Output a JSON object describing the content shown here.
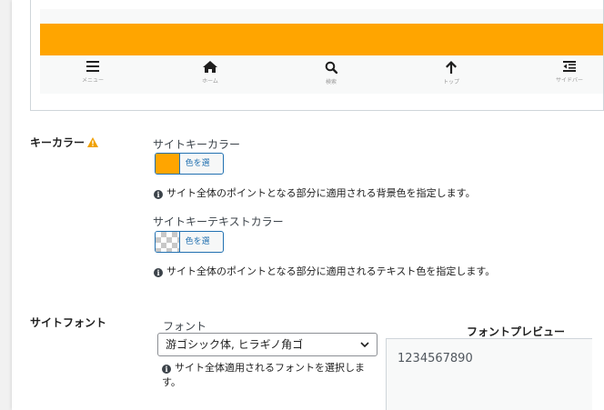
{
  "preview": {
    "accent_color": "#ffa500",
    "nav": [
      {
        "icon": "menu-icon",
        "label": "メニュー"
      },
      {
        "icon": "home-icon",
        "label": "ホーム"
      },
      {
        "icon": "search-icon",
        "label": "検索"
      },
      {
        "icon": "arrow-up-icon",
        "label": "トップ"
      },
      {
        "icon": "sidebar-icon",
        "label": "サイドバー"
      }
    ]
  },
  "key_color": {
    "section_label": "キーカラー",
    "site_key_color": {
      "label": "サイトキーカラー",
      "button_label": "色を選択",
      "value": "#ffa500",
      "help": "サイト全体のポイントとなる部分に適用される背景色を指定します。"
    },
    "site_key_text_color": {
      "label": "サイトキーテキストカラー",
      "button_label": "色を選択",
      "help": "サイト全体のポイントとなる部分に適用されるテキスト色を指定します。"
    }
  },
  "site_font": {
    "section_label": "サイトフォント",
    "font_label": "フォント",
    "selected_font": "游ゴシック体, ヒラギノ角ゴ",
    "help": "サイト全体適用されるフォントを選択します。",
    "preview_title": "フォントプレビュー",
    "preview_text": "1234567890"
  }
}
